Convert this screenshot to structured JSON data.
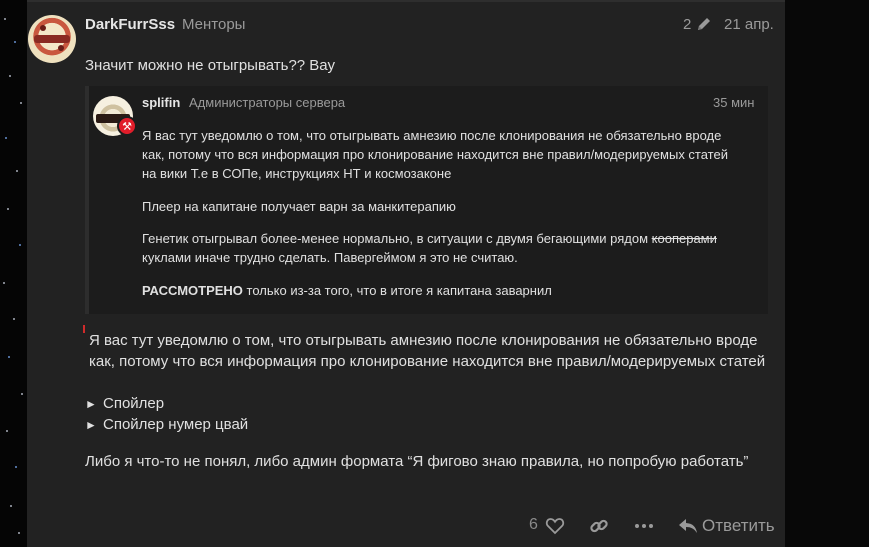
{
  "post": {
    "username": "DarkFurrSss",
    "usergroup": "Менторы",
    "edit_count": "2",
    "date": "21 апр.",
    "first_line": "Значит можно не отыгрывать?? Вау",
    "quote": {
      "username": "splifin",
      "usergroup": "Администраторы сервера",
      "time": "35 мин",
      "para1": [
        "Я вас тут уведомлю о том, что отыгрывать амнезию после клонирования не обязательно вроде",
        "как, потому что вся информация про клонирование находится вне правил/модерируемых статей",
        "на вики Т.е в СОПе, инструкциях НТ и космозаконе"
      ],
      "para2": "Плеер на капитане получает варн за манкитерапию",
      "para3_line1_a": "Генетик отыгрывал более-менее нормально, в ситуации с двумя бегающими рядом ",
      "para3_line1_strike": "кооперами",
      "para3_line2": "куклами иначе трудно сделать. Павергеймом я это не считаю.",
      "para4_bold": "РАССМОТРЕНО",
      "para4_rest": " только из-за того, что в итоге я капитана заварнил"
    },
    "selection_quote": [
      "Я вас тут уведомлю о том, что отыгрывать амнезию после клонирования не обязательно вроде",
      "как, потому что вся информация про клонирование находится вне правил/модерируемых статей"
    ],
    "spoilers": [
      "Спойлер",
      "Спойлер нумер цвай"
    ],
    "closing": "Либо я что-то не понял, либо админ формата “Я фигово знаю правила, но попробую работать”"
  },
  "actions": {
    "like_count": "6",
    "reply_label": "Ответить"
  },
  "icons": {
    "edit": "pencil-icon",
    "like": "heart-icon",
    "share": "link-icon",
    "more": "ellipsis-icon",
    "reply": "reply-arrow-icon",
    "moderator": "gavel-icon"
  },
  "colors": {
    "post_bg": "#222222",
    "quote_bg": "#1c1c1c",
    "badge_red": "#e11d2a"
  }
}
